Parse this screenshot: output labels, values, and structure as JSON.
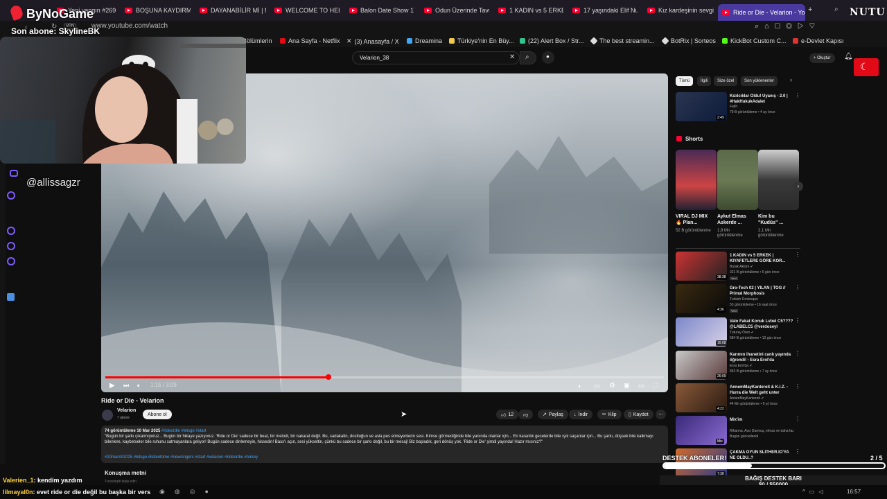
{
  "browser": {
    "tabs": [
      "Yeni yangın #269",
      "BOŞUNA KAYDIRMA",
      "DAYANABİLİR Mİ | M",
      "WELCOME TO HELL",
      "Balon Date Show 17",
      "Odun Üzerinde Tavu",
      "1 KADIN vs 5 ERKEK",
      "17 yaşındaki Elif Nur",
      "Kız kardeşinin sevgi",
      "Ride or Die - Velarion - Yo"
    ],
    "url": "www.youtube.com/watch",
    "vpn_badge": "VPN",
    "bookmarks": [
      "Bölümlerin",
      "Ana Sayfa - Netflix",
      "(3) Anasayfa / X",
      "Dreamina",
      "Türkiye'nin En Büy...",
      "(22) Alert Box / Str...",
      "The best streamin...",
      "BotRix | Sorteos",
      "KickBot Custom C...",
      "e-Devlet Kapısı"
    ]
  },
  "youtube": {
    "search_value": "Velarion_38",
    "create_label": "+ Oluştur",
    "video": {
      "title": "Ride or Die - Velarion",
      "time": "1:15 / 3:09",
      "progress": 0.4,
      "channel": "Velarion",
      "subs": "7 abone",
      "subscribe": "Abone ol",
      "likes": "12",
      "share": "Paylaş",
      "download": "İndir",
      "clip": "Klip",
      "save": "Kaydet",
      "meta": "74 görüntüleme  10 Mar 2025",
      "meta_tags": "#rideordie #letsgo #start",
      "desc": "\"Bugün bir şarkı çıkarmıyoruz... Bugün bir hikaye yazıyoruz. 'Ride or Die' sadece bir beat, bir melodi, bir nakarat değil. Bu, sadakatin, dostluğun ve asla pes etmeyenlerin sesi. Kimse görmediğinde bile yanında olanlar için... En karanlık gecelerde bile ışık saçanlar için... Bu şarkı, düşsek bile kalkmayı bilenlere, kaybetseler bile ruhunu satmayanlara geliyor! Bugün sadece dinlemeyin, hissedin! Bass'ı açın, sesi yükseltin, çünkü bu sadece bir şarkı değil, bu bir mesaj! Biz başladık, geri dönüş yok. 'Ride or Die' şimdi yayında! Hazır mısınız?\"",
      "hashtags": "#10march2025 #letsgo #listentome #newsingers #start #velarion #rideordie #turkey",
      "transcript_label": "Konuşma metni",
      "transcript_hint": "Transkripti takip edin"
    },
    "chips": [
      "Tümü",
      "İlgili",
      "Size özel",
      "Son yüklenenler"
    ],
    "shorts_label": "Shorts",
    "shorts": [
      {
        "title": "VIRAL DJ MIX🔥 Plan...",
        "views": "52 B görüntülenme"
      },
      {
        "title": "Aykut Elmas Askerde ...",
        "views": "1,9 Mn görüntülenme"
      },
      {
        "title": "Kim bu \"Kudüs\" ...",
        "views": "2,1 Mn görüntülenme"
      }
    ],
    "related": [
      {
        "title": "Kızılcıklar Oldu! Uyanış - 2.0 | #HakHukukAdalet",
        "channel": "Fatih",
        "meta": "79 B görüntüleme • 4 ay önce",
        "dur": "2:49"
      },
      {
        "title": "1 KADIN vs 5 ERKEK | KIYAFETLERE GÖRE KOR...",
        "channel": "Burak Aktürk ✔",
        "meta": "321 B görüntüleme • 5 gün önce",
        "dur": "38:38"
      },
      {
        "title": "Gro-Tech 02 | YILAN | TOG // Primal Morphosis",
        "channel": "Turkish Grotesque",
        "meta": "53 görüntüleme • 16 saat önce",
        "dur": "4:36"
      },
      {
        "title": "Valo Fakat Konuk Lvbel C5???? @LABELC5 @verdoseyl",
        "channel": "Tuturay Ören ✔",
        "meta": "684 B görüntüleme • 13 gün önce",
        "dur": "16:08"
      },
      {
        "title": "Karımın ihanetini canlı yayında öğrendi! - Esra Erol'da",
        "channel": "Esra Erol'da ✔",
        "meta": "863 B görüntüleme • 7 ay önce",
        "dur": "26:09"
      },
      {
        "title": "AnnemMayKantereit & K.I.Z. - Hurra die Welt geht unter",
        "channel": "AnnenMayKantereit ✔",
        "meta": "44 Mn görüntüleme • 9 yıl önce",
        "dur": "4:22"
      },
      {
        "title": "Mix'im",
        "channel": "Rihanna, Avci Durmuş, elmas ve daha faz...",
        "meta": "Bugün güncellendi",
        "dur": "Mix"
      },
      {
        "title": "ÇAKMA OYUN SLITHER.IO'YA NE OLDU..?",
        "channel": "",
        "meta": "",
        "dur": "7:38"
      }
    ],
    "new_badge": "Yeni"
  },
  "stream": {
    "brand": "ByNoGame",
    "last_sub": "Son abone: SkylineBK",
    "social": "@allissagzr",
    "nutu": "NUTU",
    "goal_label": "DESTEK ABONELER!",
    "goal_count": "2 / 5",
    "donation_label": "BAĞIŞ DESTEK BARI",
    "donation_value": "$0 / $50000",
    "chat": [
      {
        "user": "Valerien_1",
        "msg": ": kendim yazdım"
      },
      {
        "user": "lilmayal0n",
        "msg": ": evet ride or die değil bu başka bir vers"
      }
    ],
    "clock": "16:57"
  },
  "colors": {
    "yt_red": "#ff0033",
    "stream_purple": "#7c5cff",
    "chat_user": "#ffd23f"
  }
}
